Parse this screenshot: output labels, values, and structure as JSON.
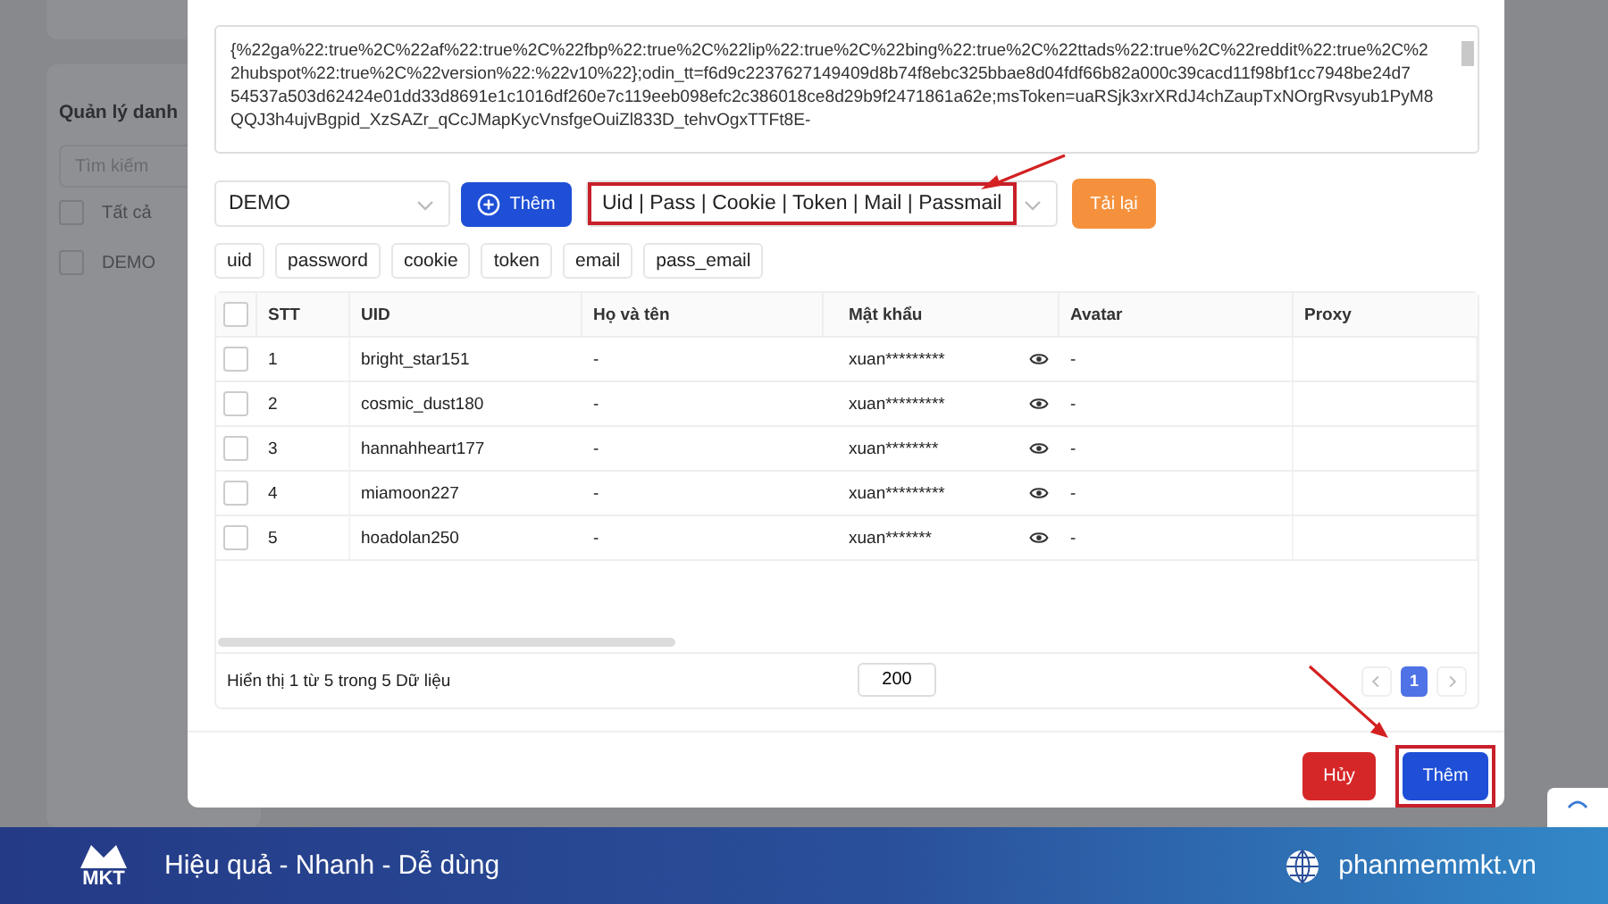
{
  "background_panel": {
    "title": "Quản lý danh",
    "search": {
      "placeholder": "Tìm kiếm"
    },
    "groups": [
      {
        "label": "Tất cả",
        "checked": false
      },
      {
        "label": "DEMO",
        "checked": false
      }
    ]
  },
  "dialog": {
    "cookie_text": [
      "{%22ga%22:true%2C%22af%22:true%2C%22fbp%22:true%2C%22lip%22:true%2C%22bing%22:true%2C%22ttads%22:true%2C%22reddit%22:true%2C%2",
      "2hubspot%22:true%2C%22version%22:%22v10%22};odin_tt=f6d9c2237627149409d8b74f8ebc325bbae8d04fdf66b82a000c39cacd11f98bf1cc7948be24d7",
      "54537a503d62424e01dd33d8691e1c1016df260e7c119eeb098efc2c386018ce8d29b9f2471861a62e;msToken=uaRSjk3xrXRdJ4chZaupTxNOrgRvsyub1PyM8",
      "QQJ3h4ujvBgpid_XzSAZr_qCcJMapKycVnsfgeOuiZl833D_tehvOgxTTFt8E-"
    ],
    "group_select": {
      "value": "DEMO"
    },
    "add_button": {
      "label": "Thêm"
    },
    "format_select": {
      "value": "Uid | Pass | Cookie | Token | Mail | Passmail",
      "highlighted": true
    },
    "reload_button": {
      "label": "Tải lại"
    },
    "field_chips": [
      "uid",
      "password",
      "cookie",
      "token",
      "email",
      "pass_email"
    ],
    "table": {
      "select_all_checked": false,
      "columns": [
        "STT",
        "UID",
        "Họ và tên",
        "Mật khẩu",
        "Avatar",
        "Proxy"
      ],
      "rows": [
        {
          "checked": false,
          "stt": "1",
          "uid": "bright_star151",
          "name": "-",
          "password": "xuan*********",
          "avatar": "-"
        },
        {
          "checked": false,
          "stt": "2",
          "uid": "cosmic_dust180",
          "name": "-",
          "password": "xuan*********",
          "avatar": "-"
        },
        {
          "checked": false,
          "stt": "3",
          "uid": "hannahheart177",
          "name": "-",
          "password": "xuan********",
          "avatar": "-"
        },
        {
          "checked": false,
          "stt": "4",
          "uid": "miamoon227",
          "name": "-",
          "password": "xuan*********",
          "avatar": "-"
        },
        {
          "checked": false,
          "stt": "5",
          "uid": "hoadolan250",
          "name": "-",
          "password": "xuan*******",
          "avatar": "-"
        }
      ]
    },
    "summary": "Hiển thị 1 từ 5 trong 5 Dữ liệu",
    "page_size": "200",
    "pages": [
      {
        "label": "1",
        "selected": true
      }
    ],
    "cancel_button": {
      "label": "Hủy"
    },
    "submit_button": {
      "label": "Thêm",
      "highlighted": true
    }
  },
  "banner": {
    "logo": "MKT",
    "slogan": "Hiệu quả - Nhanh - Dễ dùng",
    "website": "phanmemmkt.vn"
  }
}
